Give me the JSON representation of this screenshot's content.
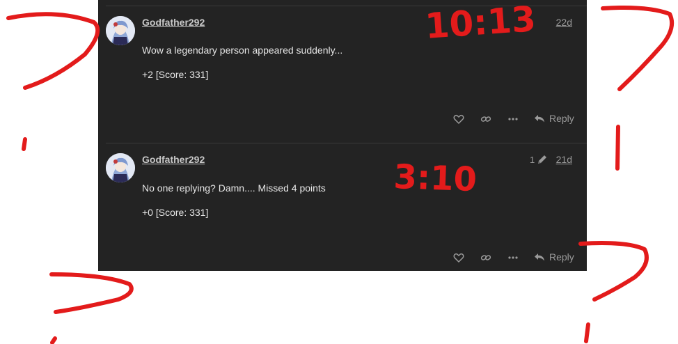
{
  "posts": [
    {
      "username": "Godfather292",
      "date": "22d",
      "edit_count": "",
      "body": "Wow a legendary person appeared suddenly...",
      "score_line": "+2 [Score: 331]",
      "reply_label": "Reply"
    },
    {
      "username": "Godfather292",
      "date": "21d",
      "edit_count": "1",
      "body": "No one replying? Damn.... Missed 4 points",
      "score_line": "+0 [Score: 331]",
      "reply_label": "Reply"
    }
  ],
  "annotations": {
    "time_1": "10:13",
    "time_2": "3:10"
  },
  "colors": {
    "panel_background": "#232323",
    "annotation_red": "#e31b1b"
  },
  "icons": [
    "heart-icon",
    "link-icon",
    "more-icon",
    "reply-arrow-icon",
    "pencil-icon"
  ]
}
